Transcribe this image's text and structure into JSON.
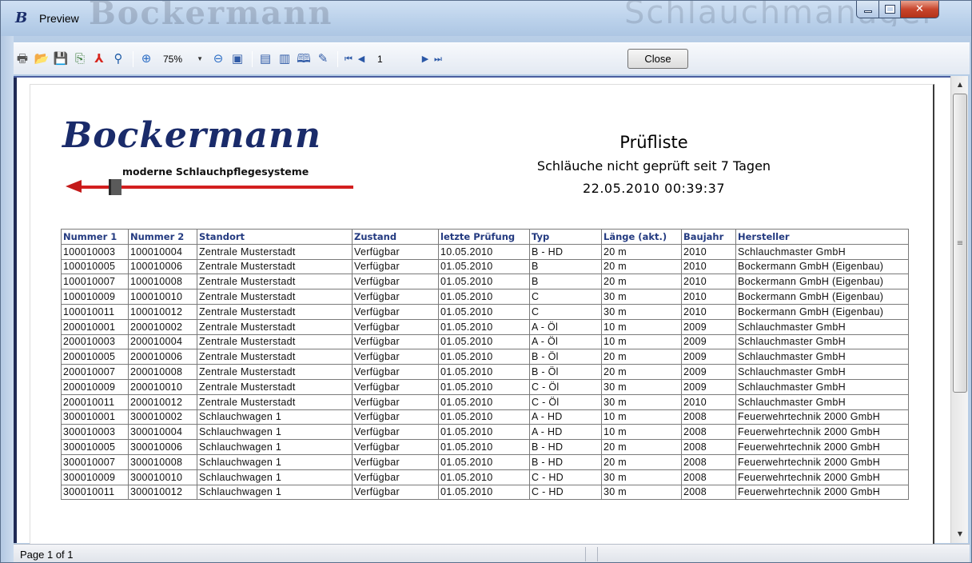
{
  "window": {
    "title": "Preview",
    "app_icon": "B",
    "ghost_left": "Bockermann",
    "ghost_right": "Schlauchmanager"
  },
  "toolbar": {
    "zoom_value": "75%",
    "page_value": "1",
    "close_label": "Close",
    "icons": [
      "print-icon",
      "open-icon",
      "save-icon",
      "export-icon",
      "pdf-icon",
      "find-icon",
      "zoom-in-icon",
      "zoom-out-icon",
      "page-width-icon",
      "single-page-icon",
      "multi-page-icon",
      "book-icon",
      "edit-icon",
      "first-page-icon",
      "prev-page-icon",
      "next-page-icon",
      "last-page-icon"
    ]
  },
  "report": {
    "logo_word": "Bockermann",
    "logo_tagline": "moderne Schlauchpflegesysteme",
    "title": "Prüfliste",
    "subtitle": "Schläuche nicht geprüft seit 7 Tagen",
    "date": "22.05.2010 00:39:37",
    "columns": [
      "Nummer 1",
      "Nummer 2",
      "Standort",
      "Zustand",
      "letzte Prüfung",
      "Typ",
      "Länge (akt.)",
      "Baujahr",
      "Hersteller"
    ],
    "rows": [
      [
        "100010003",
        "100010004",
        "Zentrale Musterstadt",
        "Verfügbar",
        "10.05.2010",
        "B - HD",
        "20 m",
        "2010",
        "Schlauchmaster GmbH"
      ],
      [
        "100010005",
        "100010006",
        "Zentrale Musterstadt",
        "Verfügbar",
        "01.05.2010",
        "B",
        "20 m",
        "2010",
        "Bockermann GmbH (Eigenbau)"
      ],
      [
        "100010007",
        "100010008",
        "Zentrale Musterstadt",
        "Verfügbar",
        "01.05.2010",
        "B",
        "20 m",
        "2010",
        "Bockermann GmbH (Eigenbau)"
      ],
      [
        "100010009",
        "100010010",
        "Zentrale Musterstadt",
        "Verfügbar",
        "01.05.2010",
        "C",
        "30 m",
        "2010",
        "Bockermann GmbH (Eigenbau)"
      ],
      [
        "100010011",
        "100010012",
        "Zentrale Musterstadt",
        "Verfügbar",
        "01.05.2010",
        "C",
        "30 m",
        "2010",
        "Bockermann GmbH (Eigenbau)"
      ],
      [
        "200010001",
        "200010002",
        "Zentrale Musterstadt",
        "Verfügbar",
        "01.05.2010",
        "A - Öl",
        "10 m",
        "2009",
        "Schlauchmaster GmbH"
      ],
      [
        "200010003",
        "200010004",
        "Zentrale Musterstadt",
        "Verfügbar",
        "01.05.2010",
        "A - Öl",
        "10 m",
        "2009",
        "Schlauchmaster GmbH"
      ],
      [
        "200010005",
        "200010006",
        "Zentrale Musterstadt",
        "Verfügbar",
        "01.05.2010",
        "B - Öl",
        "20 m",
        "2009",
        "Schlauchmaster GmbH"
      ],
      [
        "200010007",
        "200010008",
        "Zentrale Musterstadt",
        "Verfügbar",
        "01.05.2010",
        "B - Öl",
        "20 m",
        "2009",
        "Schlauchmaster GmbH"
      ],
      [
        "200010009",
        "200010010",
        "Zentrale Musterstadt",
        "Verfügbar",
        "01.05.2010",
        "C - Öl",
        "30 m",
        "2009",
        "Schlauchmaster GmbH"
      ],
      [
        "200010011",
        "200010012",
        "Zentrale Musterstadt",
        "Verfügbar",
        "01.05.2010",
        "C - Öl",
        "30 m",
        "2010",
        "Schlauchmaster GmbH"
      ],
      [
        "300010001",
        "300010002",
        "Schlauchwagen 1",
        "Verfügbar",
        "01.05.2010",
        "A - HD",
        "10 m",
        "2008",
        "Feuerwehrtechnik 2000 GmbH"
      ],
      [
        "300010003",
        "300010004",
        "Schlauchwagen 1",
        "Verfügbar",
        "01.05.2010",
        "A - HD",
        "10 m",
        "2008",
        "Feuerwehrtechnik 2000 GmbH"
      ],
      [
        "300010005",
        "300010006",
        "Schlauchwagen 1",
        "Verfügbar",
        "01.05.2010",
        "B - HD",
        "20 m",
        "2008",
        "Feuerwehrtechnik 2000 GmbH"
      ],
      [
        "300010007",
        "300010008",
        "Schlauchwagen 1",
        "Verfügbar",
        "01.05.2010",
        "B - HD",
        "20 m",
        "2008",
        "Feuerwehrtechnik 2000 GmbH"
      ],
      [
        "300010009",
        "300010010",
        "Schlauchwagen 1",
        "Verfügbar",
        "01.05.2010",
        "C - HD",
        "30 m",
        "2008",
        "Feuerwehrtechnik 2000 GmbH"
      ],
      [
        "300010011",
        "300010012",
        "Schlauchwagen 1",
        "Verfügbar",
        "01.05.2010",
        "C - HD",
        "30 m",
        "2008",
        "Feuerwehrtechnik 2000 GmbH"
      ]
    ]
  },
  "status": {
    "page_info": "Page 1 of 1"
  },
  "colors": {
    "header_text": "#233a80",
    "logo_blue": "#1a2b6a",
    "logo_red": "#d31f1f",
    "frame_dark": "#1f2a55"
  }
}
